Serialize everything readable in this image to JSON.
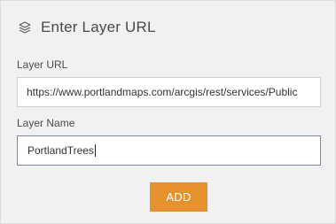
{
  "dialog": {
    "title": "Enter Layer URL",
    "icon": "layers-icon"
  },
  "form": {
    "layer_url": {
      "label": "Layer URL",
      "value": "https://www.portlandmaps.com/arcgis/rest/services/Public"
    },
    "layer_name": {
      "label": "Layer Name",
      "value": "PortlandTrees"
    },
    "add_label": "ADD"
  },
  "colors": {
    "accent": "#e5922e",
    "panel_bg": "#f1f1f1",
    "focus_border": "#7a8aa8"
  }
}
